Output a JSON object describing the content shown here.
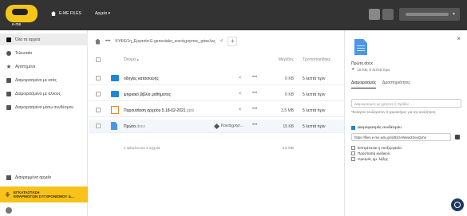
{
  "header": {
    "logo_text": "e-me",
    "brand_label": "E-ME FILES",
    "apps_label": "Αρχεία",
    "apps_chevron": "▾",
    "user_chevron": "▾"
  },
  "sidebar": {
    "items": [
      {
        "label": "Όλα τα αρχεία",
        "icon": "folder-icon"
      },
      {
        "label": "Τελευταία",
        "icon": "clock-icon"
      },
      {
        "label": "Αγαπημένα",
        "icon": "star-icon"
      },
      {
        "label": "Διαμοιρασμένα με εσάς",
        "icon": "share-icon"
      },
      {
        "label": "Διαμοιρασμένα με άλλους",
        "icon": "share-icon"
      },
      {
        "label": "Διαμοιρασμένα μέσω συνδέσμου",
        "icon": "link-icon"
      }
    ],
    "trash_label": "Διαγραμμένα αρχεία",
    "install_line1": "ΕΓΚΑΤΑΣΤΑΣΗ",
    "install_line2": "ΕΦΑΡΜΟΓΩΝ ΣΥΓΧΡΟΝΙΣΜΟΥ &..."
  },
  "breadcrumb": {
    "more": "•••",
    "path": "ΚΥΦΕ/1η_Εργασία-Ε-genesiako_κοινόχρηστος_φάκελος",
    "share_icon": "<",
    "plus": "+"
  },
  "table": {
    "col_name": "Όνομα ▴",
    "col_size": "Μέγεθος",
    "col_modified": "Τροποποιήθηκε",
    "rows": [
      {
        "name": "οδηγίες κατασκευής",
        "ext": "",
        "type": "folder",
        "size": "0 KB",
        "date": "5 λεπτά πριν"
      },
      {
        "name": "ψηφιακό βιβλίο μαθήματος",
        "ext": "",
        "type": "folder",
        "size": "0 KB",
        "date": "5 λεπτά πριν"
      },
      {
        "name": "Παρουσίαση αρχείου 5.18-02-2021",
        "ext": ".pptx",
        "type": "pptx",
        "size": "3.5 MB",
        "date": "5 λεπτά πριν"
      },
      {
        "name": "Πρώτο",
        "ext": ".docx",
        "type": "doc",
        "size": "15 KB",
        "date": "5 λεπτά πριν",
        "editing": "Κοινόχρησ..."
      }
    ],
    "summary": "2 φάκελοι και 2 αρχεία",
    "summary_size": "3.5 MB"
  },
  "panel": {
    "close": "×",
    "file_name": "Πρώτο.docx",
    "meta": "15 KB, 5 λεπτά πριν",
    "tab_sharing": "Διαμοιρασμός",
    "tab_activity": "Δραστηριότητες",
    "share_placeholder": "Διαμοιρασμός με χρήστες ή Ομάδες...",
    "hint": "*Εισάγετε τουλάχιστον 3 χαρακτήρες για την αναζήτηση",
    "link_label": "Διαμοιρασμός συνδέσμου",
    "link_url": "https://files.e-me.edu.gr/s/BSzeWww2SeyQxtVi",
    "opt_allow_edit": "Επιτρέπεται η επεξεργασία",
    "opt_password": "Προστασία κωδικού",
    "opt_expiry": "Ορισμός ημ. λήξης"
  }
}
